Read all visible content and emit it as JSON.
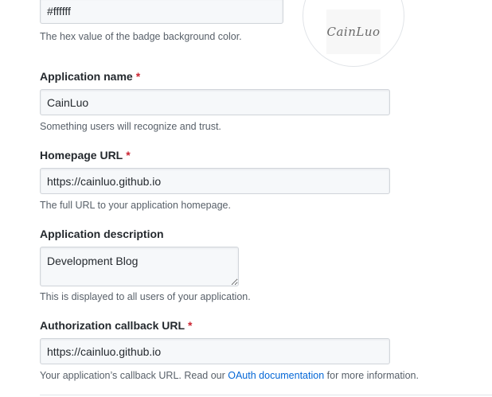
{
  "badge_color": {
    "value": "#ffffff",
    "note": "The hex value of the badge background color."
  },
  "badge_preview": {
    "logo_text": "CainLuo"
  },
  "application_name": {
    "label": "Application name",
    "required_mark": "*",
    "value": "CainLuo",
    "note": "Something users will recognize and trust."
  },
  "homepage_url": {
    "label": "Homepage URL",
    "required_mark": "*",
    "value": "https://cainluo.github.io",
    "note": "The full URL to your application homepage."
  },
  "application_description": {
    "label": "Application description",
    "value": "Development Blog",
    "note": "This is displayed to all users of your application."
  },
  "callback_url": {
    "label": "Authorization callback URL",
    "required_mark": "*",
    "value": "https://cainluo.github.io",
    "note_prefix": "Your application’s callback URL. Read our ",
    "note_link": "OAuth documentation",
    "note_suffix": " for more information."
  },
  "colors": {
    "required": "#cb2431",
    "link": "#0366d6",
    "input_bg": "#f6f8fa",
    "input_border": "#d1d5da"
  }
}
